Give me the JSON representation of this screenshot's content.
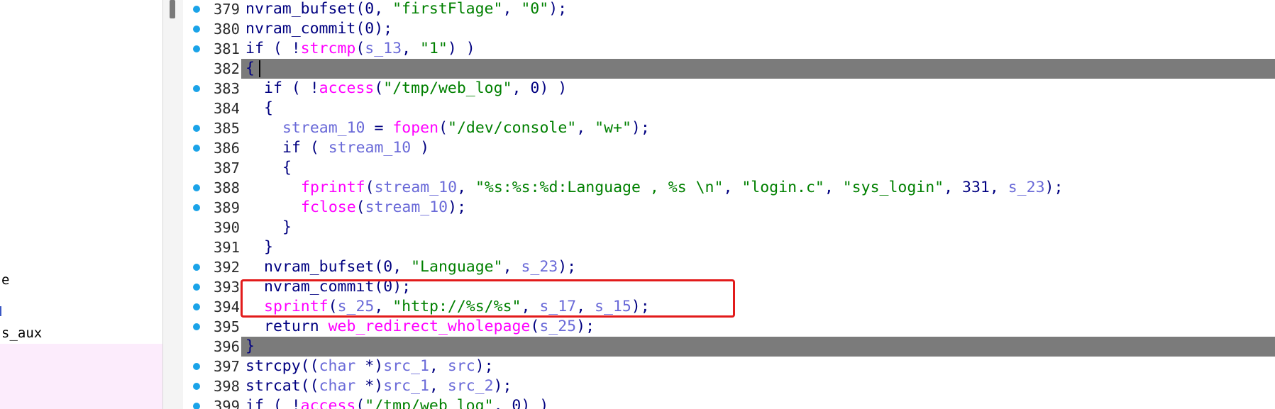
{
  "sidebar": {
    "fragments": [
      "e",
      "",
      "s_aux"
    ]
  },
  "code": {
    "lines": [
      {
        "no": "379",
        "dot": true,
        "hl": false,
        "indent": 1,
        "tokens": [
          [
            "plain",
            "nvram_bufset(0, "
          ],
          [
            "str",
            "\"firstFlage\""
          ],
          [
            "plain",
            ", "
          ],
          [
            "str",
            "\"0\""
          ],
          [
            "plain",
            ");"
          ]
        ]
      },
      {
        "no": "380",
        "dot": true,
        "hl": false,
        "indent": 1,
        "tokens": [
          [
            "plain",
            "nvram_commit(0);"
          ]
        ]
      },
      {
        "no": "381",
        "dot": true,
        "hl": false,
        "indent": 1,
        "tokens": [
          [
            "plain",
            "if ( !"
          ],
          [
            "fn",
            "strcmp"
          ],
          [
            "plain",
            "("
          ],
          [
            "var",
            "s_13"
          ],
          [
            "plain",
            ", "
          ],
          [
            "str",
            "\"1\""
          ],
          [
            "plain",
            ") )"
          ]
        ]
      },
      {
        "no": "382",
        "dot": false,
        "hl": true,
        "indent": 1,
        "caret": true,
        "tokens": [
          [
            "plain",
            "{"
          ]
        ]
      },
      {
        "no": "383",
        "dot": true,
        "hl": false,
        "indent": 2,
        "tokens": [
          [
            "plain",
            "if ( !"
          ],
          [
            "fn",
            "access"
          ],
          [
            "plain",
            "("
          ],
          [
            "str",
            "\"/tmp/web_log\""
          ],
          [
            "plain",
            ", 0) )"
          ]
        ]
      },
      {
        "no": "384",
        "dot": false,
        "hl": false,
        "indent": 2,
        "tokens": [
          [
            "plain",
            "{"
          ]
        ]
      },
      {
        "no": "385",
        "dot": true,
        "hl": false,
        "indent": 3,
        "tokens": [
          [
            "var",
            "stream_10"
          ],
          [
            "plain",
            " = "
          ],
          [
            "fn",
            "fopen"
          ],
          [
            "plain",
            "("
          ],
          [
            "str",
            "\"/dev/console\""
          ],
          [
            "plain",
            ", "
          ],
          [
            "str",
            "\"w+\""
          ],
          [
            "plain",
            ");"
          ]
        ]
      },
      {
        "no": "386",
        "dot": true,
        "hl": false,
        "indent": 3,
        "tokens": [
          [
            "plain",
            "if ( "
          ],
          [
            "var",
            "stream_10"
          ],
          [
            "plain",
            " )"
          ]
        ]
      },
      {
        "no": "387",
        "dot": false,
        "hl": false,
        "indent": 3,
        "tokens": [
          [
            "plain",
            "{"
          ]
        ]
      },
      {
        "no": "388",
        "dot": true,
        "hl": false,
        "indent": 4,
        "tokens": [
          [
            "fn",
            "fprintf"
          ],
          [
            "plain",
            "("
          ],
          [
            "var",
            "stream_10"
          ],
          [
            "plain",
            ", "
          ],
          [
            "str",
            "\"%s:%s:%d:Language , %s \\n\""
          ],
          [
            "plain",
            ", "
          ],
          [
            "str",
            "\"login.c\""
          ],
          [
            "plain",
            ", "
          ],
          [
            "str",
            "\"sys_login\""
          ],
          [
            "plain",
            ", 331, "
          ],
          [
            "var",
            "s_23"
          ],
          [
            "plain",
            ");"
          ]
        ]
      },
      {
        "no": "389",
        "dot": true,
        "hl": false,
        "indent": 4,
        "tokens": [
          [
            "fn",
            "fclose"
          ],
          [
            "plain",
            "("
          ],
          [
            "var",
            "stream_10"
          ],
          [
            "plain",
            ");"
          ]
        ]
      },
      {
        "no": "390",
        "dot": false,
        "hl": false,
        "indent": 3,
        "tokens": [
          [
            "plain",
            "}"
          ]
        ]
      },
      {
        "no": "391",
        "dot": false,
        "hl": false,
        "indent": 2,
        "tokens": [
          [
            "plain",
            "}"
          ]
        ]
      },
      {
        "no": "392",
        "dot": true,
        "hl": false,
        "indent": 2,
        "tokens": [
          [
            "plain",
            "nvram_bufset(0, "
          ],
          [
            "str",
            "\"Language\""
          ],
          [
            "plain",
            ", "
          ],
          [
            "var",
            "s_23"
          ],
          [
            "plain",
            ");"
          ]
        ]
      },
      {
        "no": "393",
        "dot": true,
        "hl": false,
        "indent": 2,
        "tokens": [
          [
            "plain",
            "nvram_commit(0);"
          ]
        ]
      },
      {
        "no": "394",
        "dot": true,
        "hl": false,
        "indent": 2,
        "tokens": [
          [
            "fn",
            "sprintf"
          ],
          [
            "plain",
            "("
          ],
          [
            "var",
            "s_25"
          ],
          [
            "plain",
            ", "
          ],
          [
            "str",
            "\"http://%s/%s\""
          ],
          [
            "plain",
            ", "
          ],
          [
            "var",
            "s_17"
          ],
          [
            "plain",
            ", "
          ],
          [
            "var",
            "s_15"
          ],
          [
            "plain",
            ");"
          ]
        ]
      },
      {
        "no": "395",
        "dot": true,
        "hl": false,
        "indent": 2,
        "tokens": [
          [
            "plain",
            "return "
          ],
          [
            "fn",
            "web_redirect_wholepage"
          ],
          [
            "plain",
            "("
          ],
          [
            "var",
            "s_25"
          ],
          [
            "plain",
            ");"
          ]
        ]
      },
      {
        "no": "396",
        "dot": false,
        "hl": true,
        "indent": 1,
        "tokens": [
          [
            "plain",
            "}"
          ]
        ]
      },
      {
        "no": "397",
        "dot": true,
        "hl": false,
        "indent": 1,
        "tokens": [
          [
            "plain",
            "strcpy(("
          ],
          [
            "var",
            "char"
          ],
          [
            "plain",
            " *)"
          ],
          [
            "var",
            "src_1"
          ],
          [
            "plain",
            ", "
          ],
          [
            "var",
            "src"
          ],
          [
            "plain",
            ");"
          ]
        ]
      },
      {
        "no": "398",
        "dot": true,
        "hl": false,
        "indent": 1,
        "tokens": [
          [
            "plain",
            "strcat(("
          ],
          [
            "var",
            "char"
          ],
          [
            "plain",
            " *)"
          ],
          [
            "var",
            "src_1"
          ],
          [
            "plain",
            ", "
          ],
          [
            "var",
            "src_2"
          ],
          [
            "plain",
            ");"
          ]
        ]
      },
      {
        "no": "399",
        "dot": true,
        "hl": false,
        "indent": 1,
        "tokens": [
          [
            "plain",
            "if ( !"
          ],
          [
            "fn",
            "access"
          ],
          [
            "plain",
            "("
          ],
          [
            "str",
            "\"/tmp/web_log\""
          ],
          [
            "plain",
            ", 0) )"
          ]
        ]
      }
    ]
  },
  "colors": {
    "function": "#ff00ff",
    "string": "#008000",
    "variable": "#6a6ad8",
    "keyword": "#000080",
    "highlight_line": "#7b7b7b",
    "breakpoint_dot": "#1aa3e8",
    "annotation_box": "#e21b1b"
  }
}
